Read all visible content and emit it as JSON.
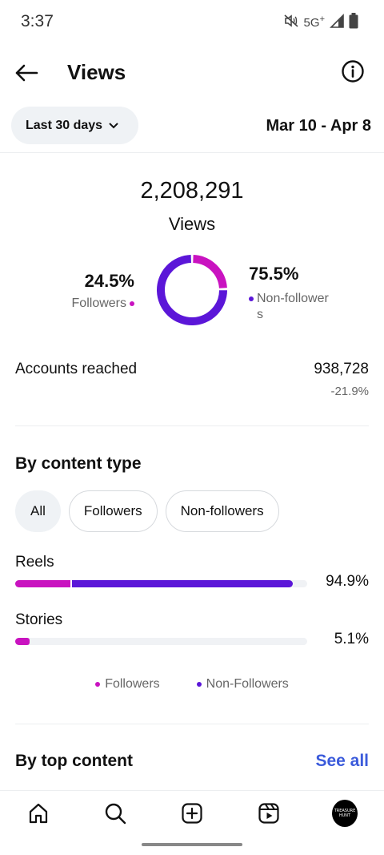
{
  "status_bar": {
    "time": "3:37",
    "network": "5G",
    "network_plus": "+"
  },
  "header": {
    "title": "Views"
  },
  "range": {
    "selector_label": "Last 30 days",
    "dates": "Mar 10 - Apr 8"
  },
  "summary": {
    "total_views": "2,208,291",
    "total_label": "Views",
    "followers_pct": "24.5%",
    "followers_label": "Followers",
    "non_followers_pct": "75.5%",
    "non_followers_label": "Non-followers",
    "followers_fraction": 0.245
  },
  "reach": {
    "label": "Accounts reached",
    "value": "938,728",
    "change": "-21.9%"
  },
  "content_type": {
    "title": "By content type",
    "filters": [
      "All",
      "Followers",
      "Non-followers"
    ],
    "active_filter": "All",
    "rows": [
      {
        "label": "Reels",
        "pct": "94.9%",
        "followers_share": 0.19,
        "non_followers_share": 0.76
      },
      {
        "label": "Stories",
        "pct": "5.1%",
        "followers_share": 0.05,
        "non_followers_share": 0.0
      }
    ],
    "legend": [
      "Followers",
      "Non-Followers"
    ]
  },
  "top_content": {
    "title": "By top content",
    "see_all": "See all"
  },
  "nav": {
    "avatar_text_1": "TREASURE",
    "avatar_text_2": "HUNT"
  },
  "colors": {
    "followers": "#c913c0",
    "non_followers": "#5b16d8",
    "link": "#3b5bdb"
  }
}
